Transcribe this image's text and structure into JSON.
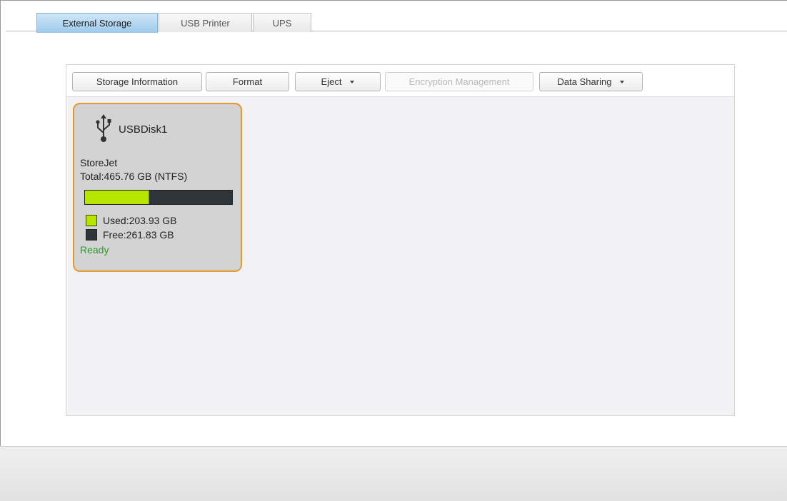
{
  "tabs": [
    {
      "label": "External Storage",
      "active": true
    },
    {
      "label": "USB Printer",
      "active": false
    },
    {
      "label": "UPS",
      "active": false
    }
  ],
  "toolbar": {
    "storage_info": "Storage Information",
    "format": "Format",
    "eject": "Eject",
    "encryption": "Encryption Management",
    "data_sharing": "Data Sharing"
  },
  "disk": {
    "name": "USBDisk1",
    "model": "StoreJet",
    "total": "Total:465.76 GB (NTFS)",
    "used": "Used:203.93 GB",
    "free": "Free:261.83 GB",
    "status": "Ready",
    "used_fraction": 0.438,
    "icon": "usb-icon"
  },
  "colors": {
    "accent_border": "#e59a2e",
    "used": "#b6e600",
    "free": "#2f3438",
    "ready": "#2d9a2d",
    "active_tab": "#9ecbec"
  }
}
